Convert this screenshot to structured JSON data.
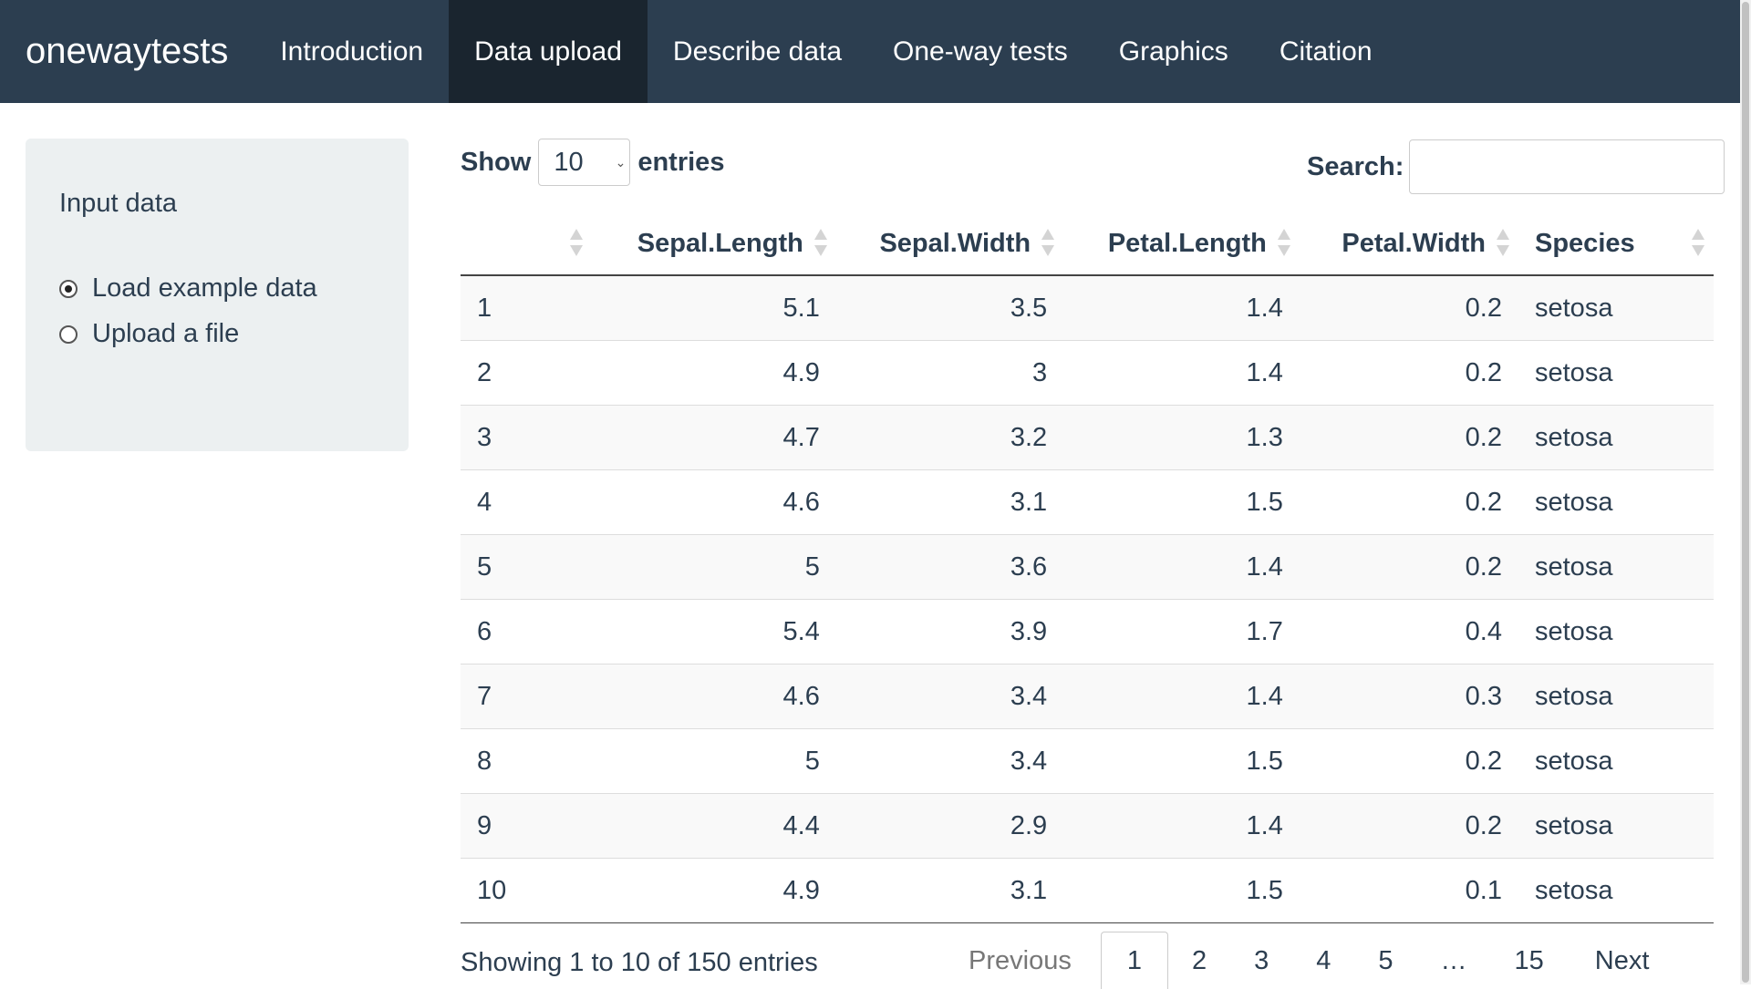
{
  "navbar": {
    "brand": "onewaytests",
    "items": [
      "Introduction",
      "Data upload",
      "Describe data",
      "One-way tests",
      "Graphics",
      "Citation"
    ],
    "active": "Data upload"
  },
  "sidebar": {
    "title": "Input data",
    "options": [
      {
        "label": "Load example data",
        "checked": true
      },
      {
        "label": "Upload a file",
        "checked": false
      }
    ]
  },
  "table_controls": {
    "show_label": "Show",
    "entries_value": "10",
    "entries_label": "entries",
    "search_label": "Search:",
    "search_value": ""
  },
  "table": {
    "columns": [
      "",
      "Sepal.Length",
      "Sepal.Width",
      "Petal.Length",
      "Petal.Width",
      "Species"
    ],
    "rows": [
      [
        "1",
        "5.1",
        "3.5",
        "1.4",
        "0.2",
        "setosa"
      ],
      [
        "2",
        "4.9",
        "3",
        "1.4",
        "0.2",
        "setosa"
      ],
      [
        "3",
        "4.7",
        "3.2",
        "1.3",
        "0.2",
        "setosa"
      ],
      [
        "4",
        "4.6",
        "3.1",
        "1.5",
        "0.2",
        "setosa"
      ],
      [
        "5",
        "5",
        "3.6",
        "1.4",
        "0.2",
        "setosa"
      ],
      [
        "6",
        "5.4",
        "3.9",
        "1.7",
        "0.4",
        "setosa"
      ],
      [
        "7",
        "4.6",
        "3.4",
        "1.4",
        "0.3",
        "setosa"
      ],
      [
        "8",
        "5",
        "3.4",
        "1.5",
        "0.2",
        "setosa"
      ],
      [
        "9",
        "4.4",
        "2.9",
        "1.4",
        "0.2",
        "setosa"
      ],
      [
        "10",
        "4.9",
        "3.1",
        "1.5",
        "0.1",
        "setosa"
      ]
    ]
  },
  "info": "Showing 1 to 10 of 150 entries",
  "pagination": {
    "previous": "Previous",
    "pages": [
      "1",
      "2",
      "3",
      "4",
      "5",
      "…",
      "15"
    ],
    "current": "1",
    "next": "Next"
  }
}
